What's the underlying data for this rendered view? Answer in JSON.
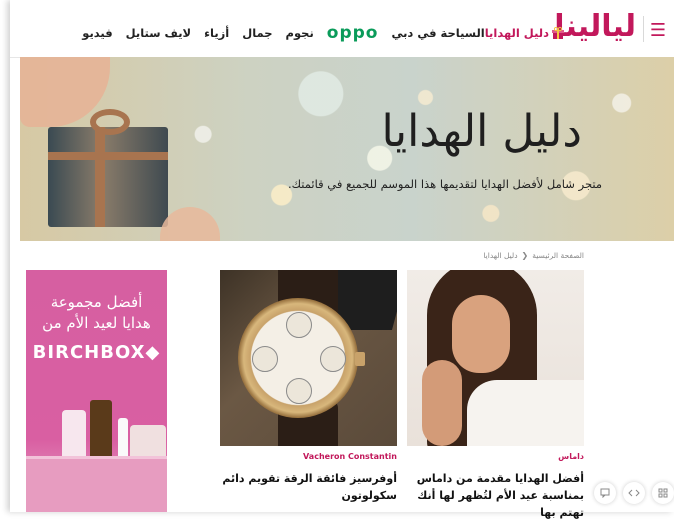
{
  "header": {
    "logo": "ليالينا",
    "nav": [
      "فيديو",
      "لايف ستايل",
      "أزياء",
      "جمال",
      "نجوم"
    ],
    "sponsor": "oppo",
    "nav_after": "السياحة في دبي",
    "gift_label": "دليل الهدايا"
  },
  "hero": {
    "title": "دليل الهدايا",
    "subtitle": "متجر شامل لأفضل الهدايا لتقديمها هذا الموسم للجميع في قائمتك."
  },
  "breadcrumb": {
    "home": "الصفحة الرئيسية",
    "current": "دليل الهدايا"
  },
  "cards": [
    {
      "category": "داماس",
      "title": "أفضل الهدايا مقدمة من داماس بمناسبة عيد الأم لتُظهر لها أنك تهتم بها"
    },
    {
      "category": "Vacheron Constantin",
      "title": "أوفرسيز فائقة الرقة تقويم دائم سكولوتون"
    }
  ],
  "ad": {
    "line1": "أفضل مجموعة",
    "line2": "هدايا لعيد الأم من",
    "brand": "BIRCHBOX◆"
  },
  "colors": {
    "accent": "#c2185b",
    "oppo": "#0a9b5a"
  }
}
